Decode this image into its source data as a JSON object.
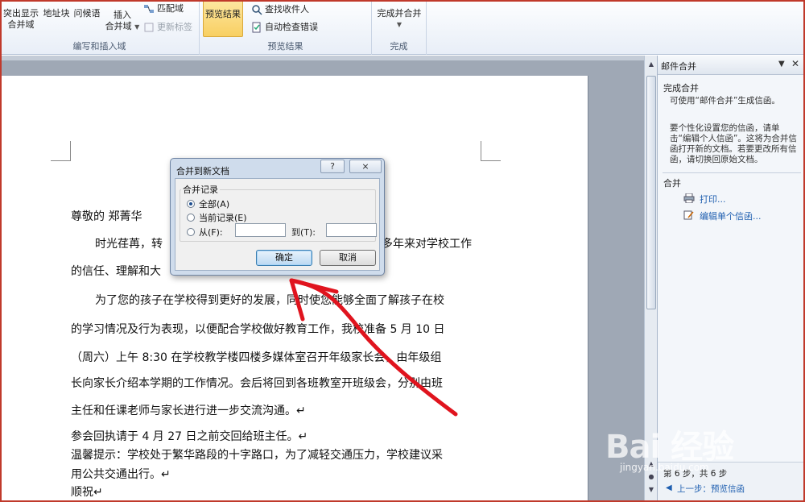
{
  "ribbon": {
    "group1": {
      "highlight_label_1": "突出显示",
      "highlight_label_2": "合并域",
      "address_block_label": "地址块",
      "greeting_label": "问候语",
      "insert_label_1": "插入",
      "insert_label_2": "合并域",
      "match_fields_label": "匹配域",
      "update_labels_label": "更新标签",
      "group_label": "编写和插入域"
    },
    "group2": {
      "preview_results_label": "预览结果",
      "find_recipient_label": "查找收件人",
      "auto_check_label": "自动检查错误",
      "group_label": "预览结果"
    },
    "group3": {
      "finish_merge_label": "完成并合并",
      "group_label": "完成"
    }
  },
  "document": {
    "salutation": "尊敬的    郑菁华",
    "lines": [
      "时光荏苒，转",
      "多年来对学校工作",
      "的信任、理解和大",
      "为了您的孩子在学校得到更好的发展，同时使您能够全面了解孩子在校",
      "的学习情况及行为表现，以便配合学校做好教育工作，我校准备 5 月 10 日",
      "（周六）上午  8:30 在学校教学楼四楼多媒体室召开年级家长会，由年级组",
      "长向家长介绍本学期的工作情况。会后将回到各班教室开班级会，分别由班",
      "主任和任课老师与家长进行进一步交流沟通。↵",
      "参会回执请于 4 月 27 日之前交回给班主任。↵",
      "温馨提示：学校处于繁华路段的十字路口，为了减轻交通压力，学校建议采",
      "用公共交通出行。↵",
      "顺祝↵"
    ]
  },
  "pane": {
    "title": "邮件合并",
    "section_complete": "完成合并",
    "text_1": "可使用“邮件合并”生成信函。",
    "text_2": "要个性化设置您的信函，请单击“编辑个人信函”。这将为合并信函打开新的文档。若要更改所有信函，请切换回原始文档。",
    "section_merge": "合并",
    "print_link": "打印...",
    "edit_link": "编辑单个信函...",
    "step_text": "第 6 步，共 6 步",
    "prev_link": "上一步：预览信函"
  },
  "dialog": {
    "title": "合并到新文档",
    "help_glyph": "?",
    "close_glyph": "⨯",
    "group_label": "合并记录",
    "opt_all": "全部(A)",
    "opt_current": "当前记录(E)",
    "opt_from": "从(F):",
    "to_label": "到(T):",
    "from_value": "",
    "to_value": "",
    "ok_label": "确定",
    "cancel_label": "取消"
  },
  "watermark": {
    "logo": "Bai 经验",
    "url": "jingyan.baidu.com"
  },
  "colors": {
    "annotation_red": "#e0141e",
    "link_blue": "#1f5fb0",
    "ribbon_active": "#f8cf62"
  }
}
